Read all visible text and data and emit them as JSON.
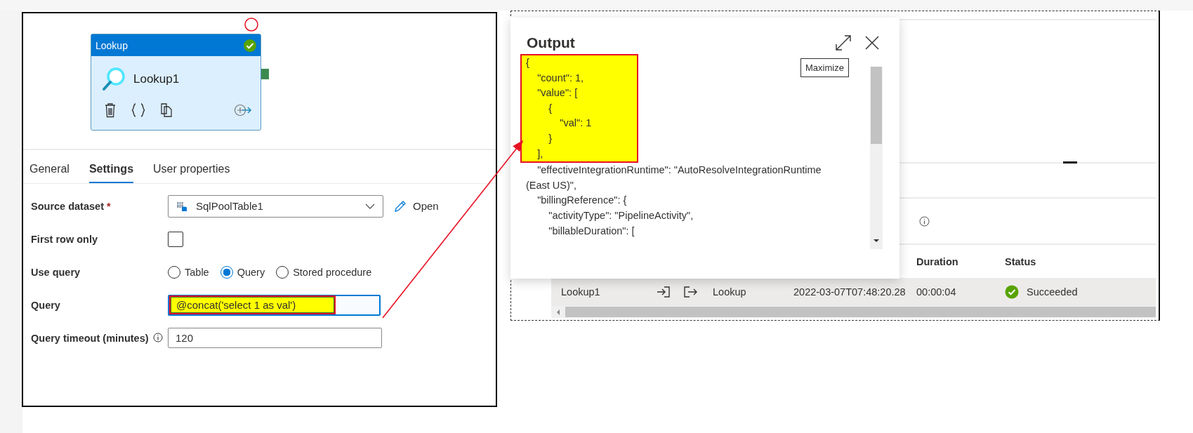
{
  "activity_node": {
    "type_label": "Lookup",
    "name": "Lookup1",
    "succeeded": true
  },
  "tabs": [
    {
      "label": "General",
      "selected": false
    },
    {
      "label": "Settings",
      "selected": true
    },
    {
      "label": "User properties",
      "selected": false
    }
  ],
  "settings": {
    "source_dataset": {
      "label": "Source dataset",
      "required_mark": "*",
      "value": "SqlPoolTable1",
      "open_label": "Open"
    },
    "first_row_only": {
      "label": "First row only",
      "checked": false
    },
    "use_query": {
      "label": "Use query",
      "options": [
        {
          "label": "Table",
          "selected": false
        },
        {
          "label": "Query",
          "selected": true
        },
        {
          "label": "Stored procedure",
          "selected": false
        }
      ]
    },
    "query": {
      "label": "Query",
      "value": "@concat('select 1 as val')",
      "highlighted": true
    },
    "query_timeout": {
      "label": "Query timeout (minutes)",
      "value": "120"
    }
  },
  "output_dialog": {
    "title": "Output",
    "tooltip": "Maximize",
    "lines": [
      {
        "text": "{",
        "highlighted": true
      },
      {
        "text": "    \"count\": 1,",
        "highlighted": true
      },
      {
        "text": "    \"value\": [",
        "highlighted": true
      },
      {
        "text": "        {",
        "highlighted": true
      },
      {
        "text": "            \"val\": 1",
        "highlighted": true
      },
      {
        "text": "        }",
        "highlighted": true
      },
      {
        "text": "    ],",
        "highlighted": true
      },
      {
        "text": "    \"effectiveIntegrationRuntime\": \"AutoResolveIntegrationRuntime (East US)\",",
        "highlighted": false
      },
      {
        "text": "    \"billingReference\": {",
        "highlighted": false
      },
      {
        "text": "        \"activityType\": \"PipelineActivity\",",
        "highlighted": false
      },
      {
        "text": "        \"billableDuration\": [",
        "highlighted": false
      }
    ]
  },
  "activity_runs": {
    "headers": [
      "Duration",
      "Status"
    ],
    "rows": [
      {
        "column_1": "Lookup1",
        "column_3": "Lookup",
        "column_4": "2022-03-07T07:48:20.28",
        "duration": "00:00:04",
        "status": "Succeeded",
        "succeeded": true
      }
    ]
  }
}
